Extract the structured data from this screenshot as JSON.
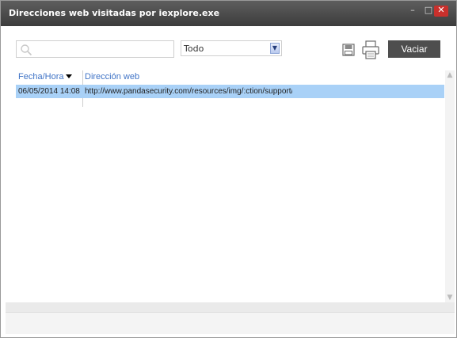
{
  "window": {
    "title": "Direcciones web visitadas por iexplore.exe",
    "minimize_glyph": "–",
    "maximize_glyph": "□",
    "close_glyph": "✕"
  },
  "toolbar": {
    "search_value": "",
    "filter_selected": "Todo",
    "save_icon": "save-icon",
    "print_icon": "print-icon",
    "clear_label": "Vaciar"
  },
  "table": {
    "columns": [
      {
        "label": "Fecha/Hora",
        "sorted": "descending"
      },
      {
        "label": "Dirección web"
      }
    ],
    "rows": [
      {
        "date": "06/05/2014 14:08",
        "url": "http://www.pandasecurity.com/resources/img/:ction/support/\\",
        "selected": true
      }
    ]
  },
  "colors": {
    "titlebar": "#4a4a4a",
    "selection": "#a9d1f7",
    "header_text": "#3f73c6",
    "button_bg": "#4e4e4e",
    "close_button": "#c9302c"
  }
}
